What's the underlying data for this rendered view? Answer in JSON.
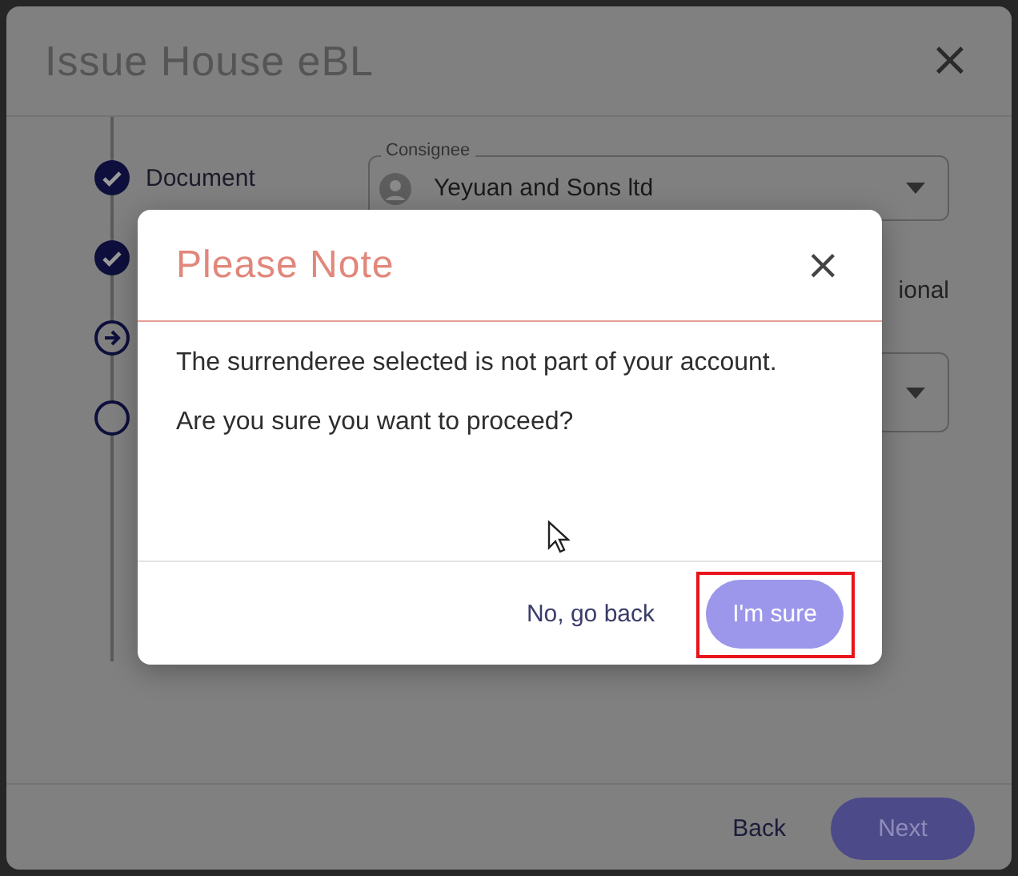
{
  "window": {
    "title": "Issue House eBL",
    "close_icon": "×"
  },
  "steps": [
    {
      "label": "Document",
      "kind": "done"
    },
    {
      "kind": "done"
    },
    {
      "kind": "current"
    },
    {
      "kind": "pending"
    }
  ],
  "consignee": {
    "label": "Consignee",
    "value": "Yeyuan and Sons ltd"
  },
  "partial_label": "ional",
  "footer": {
    "back": "Back",
    "next": "Next"
  },
  "dialog": {
    "title": "Please Note",
    "close_icon": "×",
    "messages": [
      "The surrenderee selected is not part of your account.",
      "Are you sure you want to proceed?"
    ],
    "cancel": "No, go back",
    "confirm": "I'm sure",
    "confirm_highlighted": true
  }
}
